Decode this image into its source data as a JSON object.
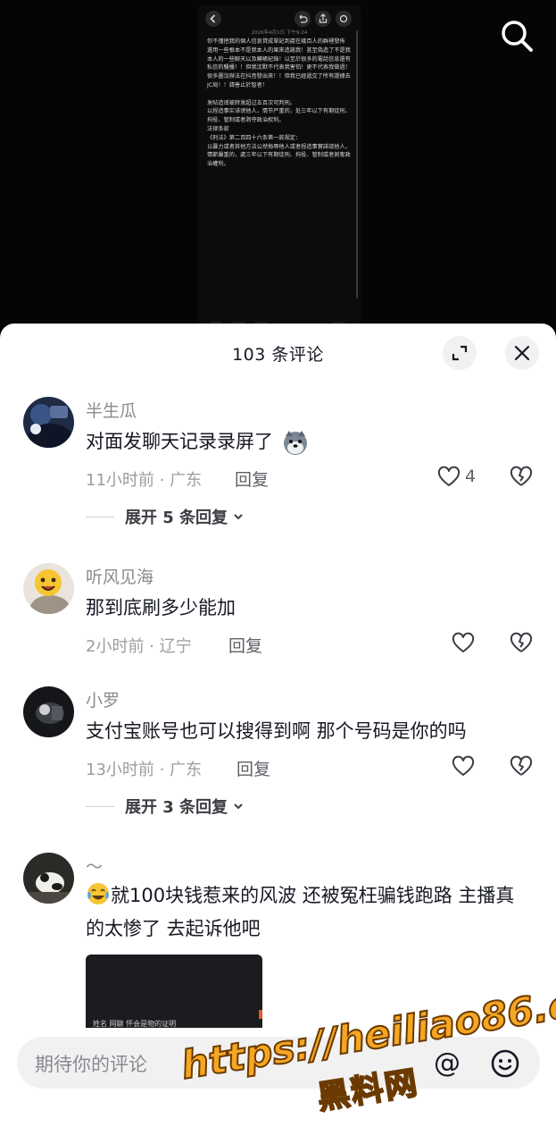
{
  "background_post": {
    "date": "2026年4月1日 下午9:24",
    "text": "你不僅把我的個人信息貸成單記到處在幾百人的群裡發佈 還用一些根本不是我本人的果來造謠我！甚至偽造了不是我本人的一些聊天以及轉帳紀錄！以至於很多的電話信息還有私信的騷擾！！但我沈默不代表我害怕！更不代表我做過！很多圖沒辦法在抖音發出來！！但我已經遞交了所有證據去JC局！！請善止於智者！\n\n发帖造谣被转发超过五百次可判刑。\n以捏造事实诽谤他人，情节严重的，处三年以下有期徒刑、拘役、管制或者剥夺政治权利。\n法律条款\n《刑法》第二百四十六条第一款规定：\n以暴力或者其他方法公然侮辱他人或者捏造事實誹謗他人，情節嚴重的，處三年以下有期徒刑、拘役、管制或者剝奪政治權利。"
  },
  "sheet": {
    "title": "103 条评论"
  },
  "comments": [
    {
      "username": "半生瓜",
      "text": "对面发聊天记录录屏了",
      "time": "11小时前 · 广东",
      "reply": "回复",
      "likes": "4",
      "expand": "展开 5 条回复"
    },
    {
      "username": "听风见海",
      "text": "那到底刷多少能加",
      "time": "2小时前 · 辽宁",
      "reply": "回复",
      "likes": ""
    },
    {
      "username": "小罗",
      "text": "支付宝账号也可以搜得到啊  那个号码是你的吗",
      "time": "13小时前 · 广东",
      "reply": "回复",
      "likes": "",
      "expand": "展开 3 条回复"
    },
    {
      "username": "～",
      "text": "就100块钱惹来的风波 还被冤枉骗钱跑路 主播真的太惨了 去起诉他吧",
      "thumb_caption": "姓名 网聊 怀会是物的证明"
    }
  ],
  "input": {
    "placeholder": "期待你的评论",
    "at_symbol": "@"
  },
  "watermark": {
    "url": "https://heiliao86.com",
    "name": "黑料网"
  },
  "icons": [
    "search-icon",
    "back-icon",
    "share-icon",
    "fullscreen-icon",
    "close-icon",
    "heart-icon",
    "broken-heart-icon",
    "chevron-down-icon",
    "emoji-icon",
    "at-icon",
    "laugh-cry-emoji",
    "wolf-emoji"
  ],
  "colors": {
    "text_primary": "#161823",
    "text_secondary": "#8a8b91",
    "sheet_bg": "#ffffff",
    "input_bg": "#f1f1f2",
    "watermark": "#f5a623"
  }
}
